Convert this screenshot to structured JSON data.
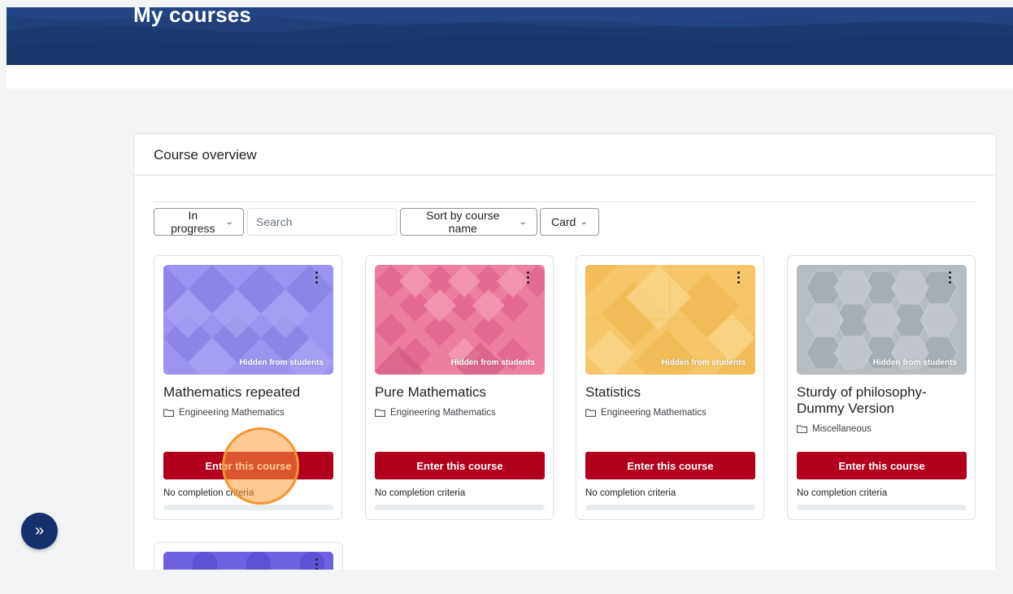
{
  "header": {
    "title": "My courses",
    "banner_color": "#1f3f7a"
  },
  "overview": {
    "title": "Course overview",
    "filter": {
      "label": "In progress"
    },
    "search": {
      "placeholder": "Search",
      "value": ""
    },
    "sort": {
      "label": "Sort by course name"
    },
    "view": {
      "label": "Card"
    }
  },
  "courses": [
    {
      "name": "Mathematics repeated",
      "category": "Engineering Mathematics",
      "badge": "Hidden from students",
      "enter_label": "Enter this course",
      "completion": "No completion criteria",
      "image_color": "#9b94f0"
    },
    {
      "name": "Pure Mathematics",
      "category": "Engineering Mathematics",
      "badge": "Hidden from students",
      "enter_label": "Enter this course",
      "completion": "No completion criteria",
      "image_color": "#ec7fa0"
    },
    {
      "name": "Statistics",
      "category": "Engineering Mathematics",
      "badge": "Hidden from students",
      "enter_label": "Enter this course",
      "completion": "No completion criteria",
      "image_color": "#f7c66a"
    },
    {
      "name": "Sturdy of philosophy-Dummy Version",
      "category": "Miscellaneous",
      "badge": "Hidden from students",
      "enter_label": "Enter this course",
      "completion": "No completion criteria",
      "image_color": "#b5bcc2"
    }
  ],
  "icons": {
    "dropdown": "chevron-down-icon",
    "more": "kebab-menu-icon",
    "category": "folder-icon",
    "drawer": "double-chevron-right-icon"
  },
  "accent_color": "#b0001e"
}
